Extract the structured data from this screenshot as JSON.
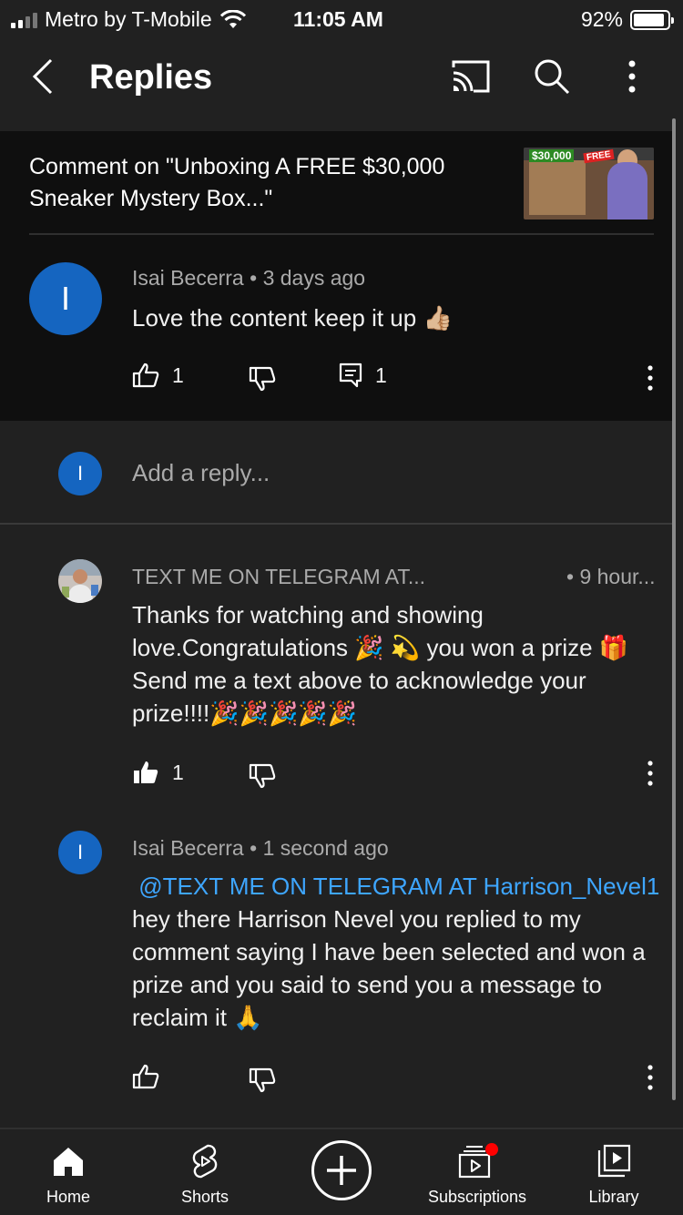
{
  "status_bar": {
    "carrier": "Metro by T-Mobile",
    "time": "11:05 AM",
    "battery": "92%"
  },
  "app_bar": {
    "title": "Replies",
    "icons": [
      "back-icon",
      "cast-icon",
      "search-icon",
      "more-vert-icon"
    ]
  },
  "video": {
    "title": "Comment on \"Unboxing A FREE $30,000 Sneaker Mystery Box...\"",
    "thumb_price": "$30,000",
    "thumb_free": "FREE"
  },
  "original_comment": {
    "avatar_letter": "I",
    "author": "Isai Becerra",
    "time": "3 days ago",
    "text": "Love the content keep it up 👍🏼",
    "likes": "1",
    "replies": "1"
  },
  "reply_input": {
    "avatar_letter": "I",
    "placeholder": "Add a reply..."
  },
  "replies": [
    {
      "author": "TEXT ME ON TELEGRAM AT...",
      "time": "9 hour...",
      "text": "Thanks for watching and showing love.Congratulations 🎉 💫 you won a prize 🎁Send me a text above to acknowledge your prize!!!!🎉🎉🎉🎉🎉",
      "likes": "1"
    },
    {
      "avatar_letter": "I",
      "author": "Isai Becerra",
      "time": "1 second ago",
      "mention": "@TEXT ME ON TELEGRAM AT Harrison_Nevel1",
      "text": " hey there Harrison Nevel you replied to my comment saying I have been selected and won a prize and you said to send you a message to reclaim it 🙏"
    }
  ],
  "bottom_nav": {
    "home": "Home",
    "shorts": "Shorts",
    "subscriptions": "Subscriptions",
    "library": "Library"
  },
  "colors": {
    "background": "#212121",
    "card": "#0f0f0f",
    "avatar": "#1565c0",
    "mention": "#3ea6ff",
    "notification_dot": "#ff0000"
  }
}
